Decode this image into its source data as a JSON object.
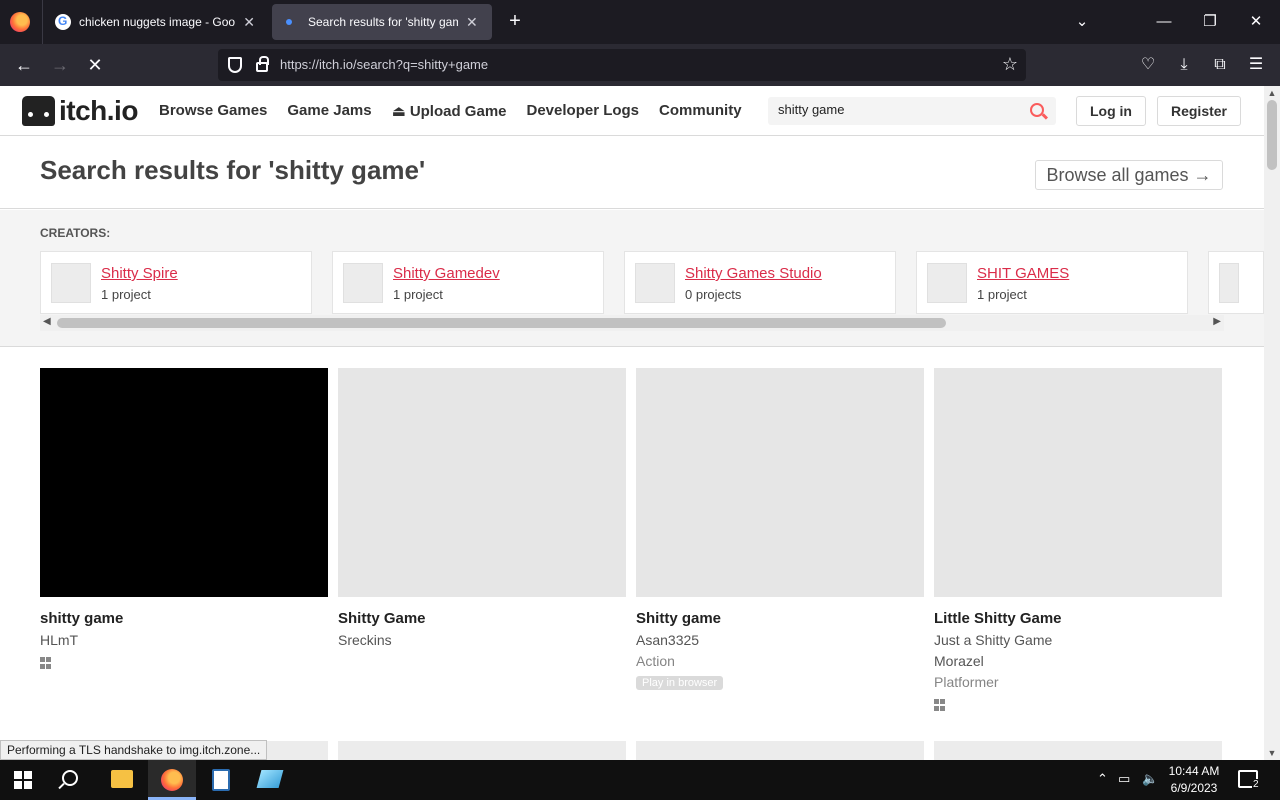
{
  "browser": {
    "tabs": [
      {
        "title": "chicken nuggets image - Google Search"
      },
      {
        "title": "Search results for 'shitty game' - itch.io"
      }
    ],
    "url": "https://itch.io/search?q=shitty+game",
    "status_text": "Performing a TLS handshake to img.itch.zone..."
  },
  "site": {
    "logo_text": "itch.io",
    "nav": [
      "Browse Games",
      "Game Jams",
      "Upload Game",
      "Developer Logs",
      "Community"
    ],
    "search_value": "shitty game",
    "login_label": "Log in",
    "register_label": "Register"
  },
  "results": {
    "title": "Search results for 'shitty game'",
    "browse_all": "Browse all games →",
    "creators_label": "CREATORS:",
    "creators": [
      {
        "name": "Shitty Spire",
        "count": "1 project"
      },
      {
        "name": "Shitty Gamedev",
        "count": "1 project"
      },
      {
        "name": "Shitty Games Studio",
        "count": "0 projects"
      },
      {
        "name": "SHIT GAMES",
        "count": "1 project"
      }
    ],
    "games": [
      {
        "title": "shitty game",
        "author": "HLmT",
        "genre": "",
        "badge": "",
        "platform": "windows-icon"
      },
      {
        "title": "Shitty Game",
        "author": "Sreckins",
        "genre": "",
        "badge": "",
        "platform": ""
      },
      {
        "title": "Shitty game",
        "author": "Asan3325",
        "genre": "Action",
        "badge": "Play in browser",
        "platform": ""
      },
      {
        "title": "Little Shitty Game",
        "subtitle": "Just a Shitty Game",
        "author": "Morazel",
        "genre": "Platformer",
        "badge": "",
        "platform": "windows-icon"
      }
    ]
  },
  "taskbar": {
    "time": "10:44 AM",
    "date": "6/9/2023",
    "notifications": "2"
  }
}
